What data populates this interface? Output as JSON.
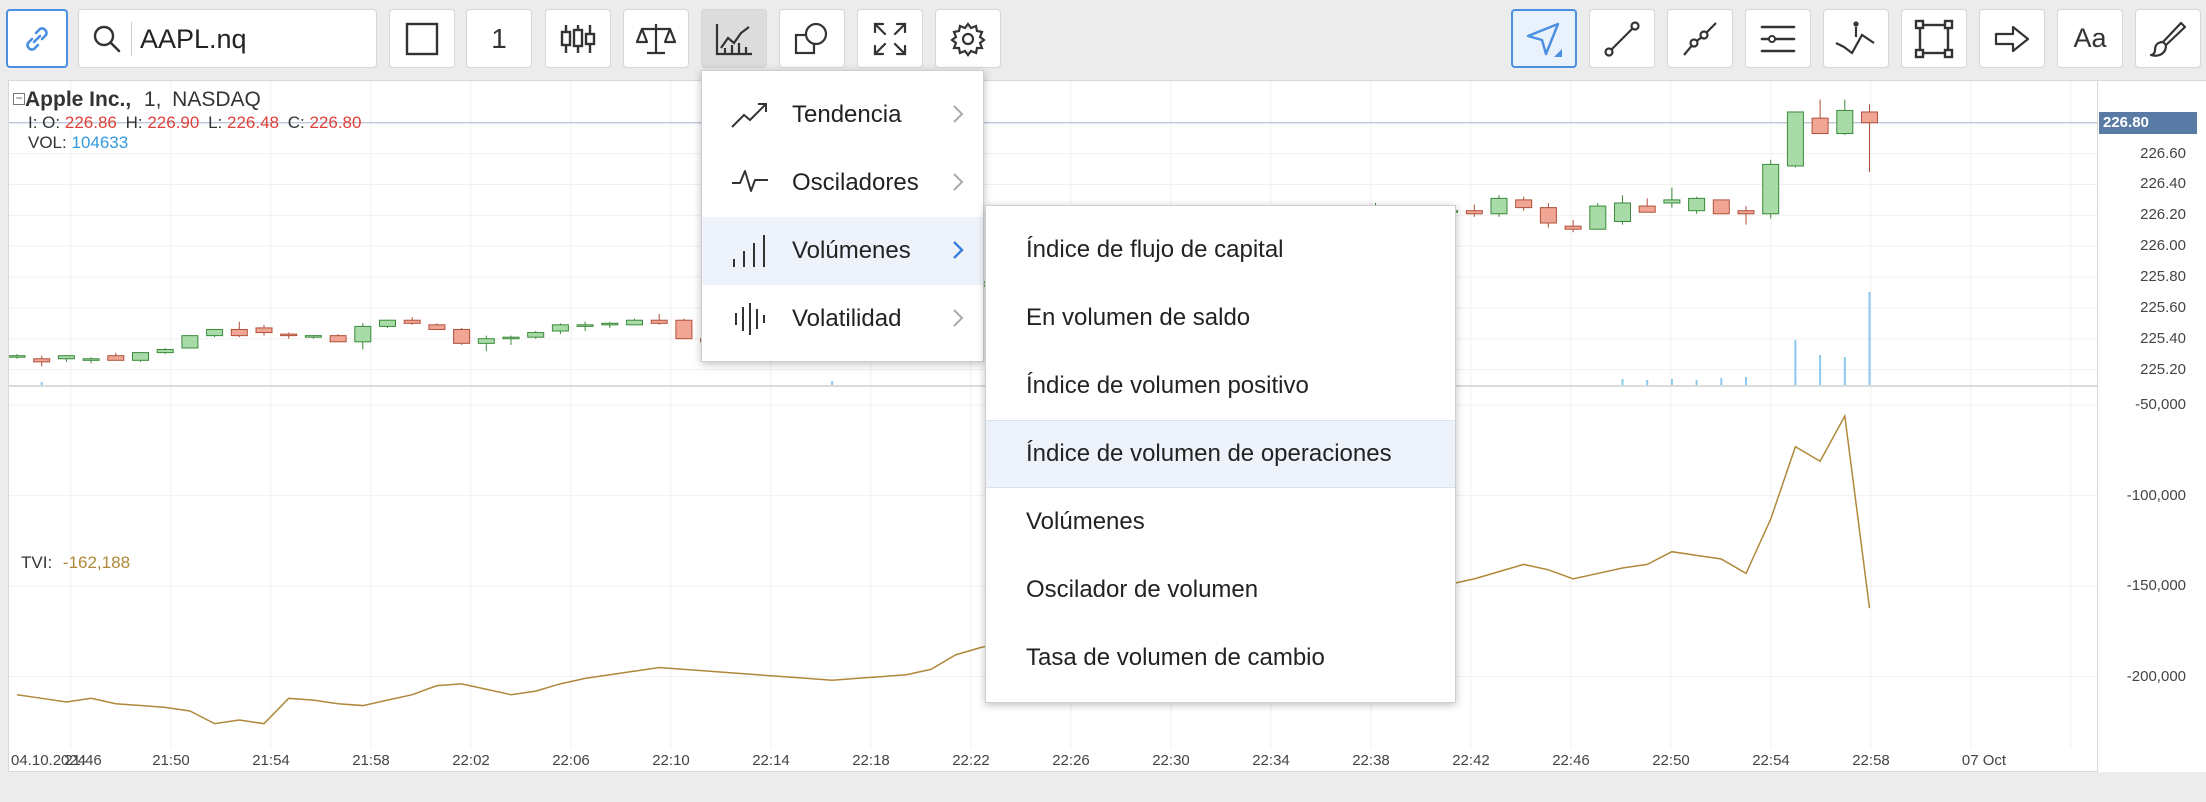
{
  "search": {
    "symbol": "AAPL.nq"
  },
  "toolbar": {
    "interval": "1",
    "font_button": "Aa"
  },
  "symbol_info": {
    "name": "Apple Inc.,",
    "interval": "1,",
    "exchange": "NASDAQ",
    "ohlc_prefix": "I: O:",
    "open": "226.86",
    "high_label": "H:",
    "high": "226.90",
    "low_label": "L:",
    "low": "226.48",
    "close_label": "C:",
    "close": "226.80",
    "vol_label": "VOL:",
    "vol": "104633"
  },
  "indicator": {
    "label": "TVI:",
    "value": "-162,188"
  },
  "price_axis": {
    "current": "226.80",
    "labels": [
      "226.60",
      "226.40",
      "226.20",
      "226.00",
      "225.80",
      "225.60",
      "225.40",
      "225.20"
    ],
    "tvi_labels": [
      "-50,000",
      "-100,000",
      "-150,000",
      "-200,000"
    ]
  },
  "time_axis": {
    "labels": [
      "04.10.2024",
      "21:46",
      "21:50",
      "21:54",
      "21:58",
      "22:02",
      "22:06",
      "22:10",
      "22:14",
      "22:18",
      "22:22",
      "22:26",
      "22:30",
      "22:34",
      "22:38",
      "22:42",
      "22:46",
      "22:50",
      "22:54",
      "22:58",
      "07 Oct"
    ]
  },
  "indicator_menu": {
    "items": [
      {
        "label": "Tendencia",
        "icon": "trend-icon"
      },
      {
        "label": "Osciladores",
        "icon": "oscillator-icon"
      },
      {
        "label": "Volúmenes",
        "icon": "volume-icon"
      },
      {
        "label": "Volatilidad",
        "icon": "volatility-icon"
      }
    ]
  },
  "volume_submenu": {
    "items": [
      "Índice de flujo de capital",
      "En volumen de saldo",
      "Índice de volumen positivo",
      "Índice de volumen de operaciones",
      "Volúmenes",
      "Oscilador de volumen",
      "Tasa de volumen de cambio"
    ]
  },
  "colors": {
    "up": "#a8dba8",
    "down": "#f0a595",
    "tvi_line": "#b0883a",
    "vol_bar": "#8cc8ee",
    "accent": "#4a8fe0"
  },
  "chart_data": {
    "type": "candlestick",
    "x": [
      "21:44",
      "21:45",
      "21:46",
      "21:47",
      "21:48",
      "21:49",
      "21:50",
      "21:51",
      "21:52",
      "21:53",
      "21:54",
      "21:55",
      "21:56",
      "21:57",
      "21:58",
      "21:59",
      "22:00",
      "22:01",
      "22:02",
      "22:03",
      "22:04",
      "22:05",
      "22:06",
      "22:07",
      "22:08",
      "22:09",
      "22:10",
      "22:11",
      "22:12",
      "22:13",
      "22:14",
      "22:15",
      "22:16",
      "22:17",
      "22:18",
      "22:19",
      "22:20",
      "22:21",
      "22:22",
      "22:23",
      "22:24",
      "22:25",
      "22:26",
      "22:27",
      "22:28",
      "22:29",
      "22:30",
      "22:31",
      "22:32",
      "22:33",
      "22:34",
      "22:35",
      "22:36",
      "22:37",
      "22:38",
      "22:39",
      "22:40",
      "22:41",
      "22:42",
      "22:43",
      "22:44",
      "22:45",
      "22:46",
      "22:47",
      "22:48",
      "22:49",
      "22:50",
      "22:51",
      "22:52",
      "22:53",
      "22:54",
      "22:55",
      "22:56",
      "22:57",
      "22:58",
      "22:59"
    ],
    "open": [
      225.28,
      225.27,
      225.27,
      225.26,
      225.29,
      225.26,
      225.31,
      225.34,
      225.42,
      225.46,
      225.47,
      225.43,
      225.41,
      225.42,
      225.38,
      225.48,
      225.52,
      225.49,
      225.46,
      225.37,
      225.4,
      225.41,
      225.45,
      225.49,
      225.49,
      225.49,
      225.52,
      225.52,
      225.4,
      225.37,
      225.4,
      225.42,
      225.37,
      225.39,
      225.42,
      225.44,
      225.52,
      225.6,
      225.68,
      225.74,
      225.78,
      225.84,
      225.9,
      225.96,
      226.0,
      226.06,
      226.12,
      226.16,
      226.18,
      226.17,
      226.14,
      226.16,
      226.13,
      226.14,
      226.12,
      226.15,
      226.18,
      226.2,
      226.22,
      226.23,
      226.21,
      226.3,
      226.25,
      226.13,
      226.11,
      226.16,
      226.26,
      226.28,
      226.23,
      226.3,
      226.23,
      226.21,
      226.52,
      226.83,
      226.73,
      226.87
    ],
    "high": [
      225.3,
      225.29,
      225.29,
      225.28,
      225.31,
      225.28,
      225.34,
      225.36,
      225.45,
      225.51,
      225.49,
      225.44,
      225.42,
      225.43,
      225.5,
      225.51,
      225.54,
      225.5,
      225.47,
      225.42,
      225.42,
      225.45,
      225.5,
      225.51,
      225.51,
      225.53,
      225.56,
      225.53,
      225.42,
      225.43,
      225.43,
      225.43,
      225.41,
      225.44,
      225.46,
      225.53,
      225.62,
      225.7,
      225.76,
      225.8,
      225.86,
      225.92,
      225.98,
      226.03,
      226.08,
      226.14,
      226.18,
      226.2,
      226.22,
      226.21,
      226.2,
      226.18,
      226.16,
      226.16,
      226.2,
      226.28,
      226.22,
      226.24,
      226.25,
      226.27,
      226.33,
      226.32,
      226.28,
      226.17,
      226.28,
      226.33,
      226.31,
      226.38,
      226.32,
      226.3,
      226.26,
      226.56,
      226.87,
      226.95,
      226.95,
      226.92
    ],
    "low": [
      225.27,
      225.22,
      225.25,
      225.24,
      225.26,
      225.25,
      225.3,
      225.34,
      225.41,
      225.41,
      225.42,
      225.4,
      225.4,
      225.39,
      225.33,
      225.47,
      225.49,
      225.48,
      225.36,
      225.32,
      225.36,
      225.4,
      225.43,
      225.45,
      225.47,
      225.49,
      225.49,
      225.46,
      225.36,
      225.35,
      225.38,
      225.37,
      225.34,
      225.35,
      225.4,
      225.43,
      225.5,
      225.58,
      225.66,
      225.72,
      225.76,
      225.82,
      225.88,
      225.94,
      225.98,
      226.04,
      226.1,
      226.14,
      226.15,
      226.12,
      226.12,
      226.12,
      226.1,
      226.11,
      226.1,
      226.14,
      226.17,
      226.18,
      226.2,
      226.19,
      226.19,
      226.23,
      226.12,
      226.09,
      226.11,
      226.14,
      226.22,
      226.25,
      226.21,
      226.22,
      226.14,
      226.18,
      226.51,
      226.73,
      226.72,
      226.48
    ],
    "close": [
      225.29,
      225.25,
      225.29,
      225.27,
      225.26,
      225.31,
      225.33,
      225.42,
      225.46,
      225.42,
      225.44,
      225.42,
      225.42,
      225.38,
      225.48,
      225.52,
      225.5,
      225.46,
      225.37,
      225.4,
      225.41,
      225.44,
      225.49,
      225.49,
      225.5,
      225.52,
      225.5,
      225.4,
      225.38,
      225.4,
      225.43,
      225.38,
      225.38,
      225.42,
      225.45,
      225.52,
      225.58,
      225.67,
      225.73,
      225.77,
      225.83,
      225.89,
      225.95,
      225.99,
      226.05,
      226.11,
      226.15,
      226.17,
      226.16,
      226.15,
      226.15,
      226.14,
      226.14,
      226.12,
      226.16,
      226.18,
      226.2,
      226.22,
      226.23,
      226.21,
      226.31,
      226.25,
      226.15,
      226.11,
      226.26,
      226.28,
      226.22,
      226.3,
      226.31,
      226.21,
      226.21,
      226.53,
      226.87,
      226.73,
      226.88,
      226.8
    ],
    "tvi": [
      -210000,
      -212000,
      -214000,
      -212000,
      -215000,
      -216000,
      -217000,
      -219000,
      -226000,
      -224000,
      -226000,
      -212000,
      -213000,
      -215000,
      -216000,
      -213000,
      -210000,
      -205000,
      -204000,
      -207000,
      -210000,
      -208000,
      -204000,
      -201000,
      -199000,
      -197000,
      -195000,
      -196000,
      -197000,
      -198000,
      -199000,
      -200000,
      -201000,
      -202000,
      -201000,
      -200000,
      -199000,
      -196000,
      -188000,
      -184000,
      -181000,
      -180000,
      -176000,
      -174000,
      -172000,
      -168000,
      -165000,
      -162000,
      -160000,
      -158000,
      -156000,
      -154000,
      -153000,
      -152000,
      -150000,
      -155000,
      -154000,
      -152000,
      -149000,
      -146000,
      -142000,
      -138000,
      -141000,
      -146000,
      -143000,
      -140000,
      -138000,
      -131000,
      -133000,
      -135000,
      -143000,
      -113000,
      -73000,
      -81000,
      -56000,
      -162188
    ],
    "ylim": [
      225.1,
      226.98
    ],
    "tvi_ylim": [
      -240000,
      -40000
    ]
  }
}
